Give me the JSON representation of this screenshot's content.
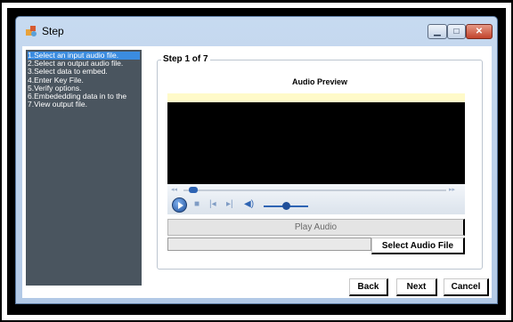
{
  "window": {
    "title": "Step"
  },
  "steps": [
    "1.Select an input audio file.",
    "2.Select an output audio file.",
    "3.Select data to embed.",
    "4.Enter Key File.",
    "5.Verify options.",
    "6.Embededding data in to the",
    "7.View output file."
  ],
  "active_step_index": 0,
  "group": {
    "title": "Step 1 of 7",
    "preview_label": "Audio Preview"
  },
  "player": {
    "seek_position": 0.02,
    "volume": 0.5
  },
  "buttons": {
    "play_audio": "Play Audio",
    "select_file": "Select Audio File",
    "back": "Back",
    "next": "Next",
    "cancel": "Cancel"
  },
  "file_path": {
    "value": ""
  },
  "colors": {
    "step_list_bg": "#4a555f",
    "active_step": "#3b8ce0",
    "preview_strip": "#fffac9"
  }
}
